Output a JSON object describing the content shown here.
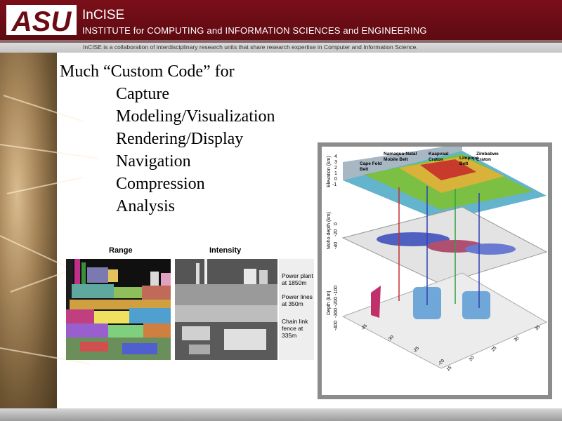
{
  "header": {
    "logo_text": "ASU",
    "title": "InCISE",
    "subtitle": "INSTITUTE for COMPUTING and INFORMATION SCIENCES and ENGINEERING",
    "tagline": "InCISE is a collaboration of interdisciplinary research units that share research expertise in Computer and Information Science."
  },
  "content": {
    "heading": "Much “Custom Code” for",
    "items": [
      "Capture",
      "Modeling/Visualization",
      "Rendering/Display",
      "Navigation",
      "Compression",
      "Analysis"
    ]
  },
  "figure_left": {
    "range_label": "Range",
    "intensity_label": "Intensity",
    "annotations": [
      "Power plant",
      "at 1850m",
      "Power lines",
      "at 350m",
      "Chain link",
      "fence at",
      "335m"
    ]
  },
  "figure_right": {
    "region_labels": [
      "Cape Fold",
      "Belt",
      "Namaqua-Natal",
      "Mobile Belt",
      "Kaapvaal",
      "Craton",
      "Limpopo",
      "Belt",
      "Zimbabwe",
      "Craton"
    ],
    "axis_elevation": "Elevation (km)",
    "elev_ticks": [
      "4",
      "3",
      "2",
      "1",
      "0",
      "-1"
    ],
    "axis_moho": "Moho depth (km)",
    "moho_ticks": [
      "0",
      "-20",
      "-40"
    ],
    "axis_depth": "Depth (km)",
    "depth_ticks": [
      "-100",
      "-200",
      "-300",
      "-400"
    ],
    "bottom_ticks": [
      "-35",
      "-30",
      "-25",
      "-20"
    ],
    "side_ticks": [
      "15",
      "20",
      "25",
      "30",
      "35"
    ]
  },
  "colors": {
    "header": "#6b0c15",
    "accent_stripe": "#8a6c6e"
  }
}
